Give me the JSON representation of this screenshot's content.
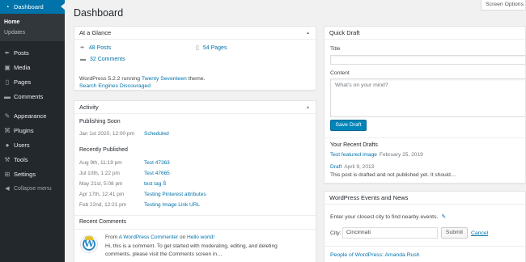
{
  "sidebar": {
    "dashboard": {
      "label": "Dashboard",
      "icon": "dashboard-icon",
      "glyph": "◔"
    },
    "submenu": [
      {
        "label": "Home"
      },
      {
        "label": "Updates"
      }
    ],
    "items": [
      {
        "label": "Posts",
        "icon": "pushpin-icon",
        "glyph": "✒"
      },
      {
        "label": "Media",
        "icon": "media-icon",
        "glyph": "▣"
      },
      {
        "label": "Pages",
        "icon": "pages-icon",
        "glyph": "▯"
      },
      {
        "label": "Comments",
        "icon": "comment-icon",
        "glyph": "▬"
      },
      {
        "label": "Appearance",
        "icon": "paintbrush-icon",
        "glyph": "✎"
      },
      {
        "label": "Plugins",
        "icon": "plugin-icon",
        "glyph": "⌘"
      },
      {
        "label": "Users",
        "icon": "users-icon",
        "glyph": "●"
      },
      {
        "label": "Tools",
        "icon": "wrench-icon",
        "glyph": "⚒"
      },
      {
        "label": "Settings",
        "icon": "settings-icon",
        "glyph": "⊞"
      },
      {
        "label": "Collapse menu",
        "icon": "collapse-icon",
        "glyph": "◀"
      }
    ]
  },
  "header": {
    "title": "Dashboard",
    "screen_options": "Screen Options"
  },
  "glance": {
    "title": "At a Glance",
    "posts": "48 Posts",
    "pages": "54 Pages",
    "comments": "32 Comments",
    "version_prefix": "WordPress 5.2.2 running ",
    "theme": "Twenty Seventeen",
    "version_suffix": " theme.",
    "seo": "Search Engines Discouraged"
  },
  "activity": {
    "title": "Activity",
    "publishing_soon": "Publishing Soon",
    "scheduled": [
      {
        "date": "Jan 1st 2020, 12:00 pm",
        "title": "Scheduled"
      }
    ],
    "recently_published": "Recently Published",
    "published": [
      {
        "date": "Aug 9th, 11:19 pm",
        "title": "Test 47363"
      },
      {
        "date": "Jul 10th, 1:22 pm",
        "title": "Test 47665"
      },
      {
        "date": "May 21st, 5:08 pm",
        "title": "test tag Ŝ"
      },
      {
        "date": "Apr 17th, 12:41 pm",
        "title": "Testing Pinterest attributes"
      },
      {
        "date": "Feb 22nd, 12:21 pm",
        "title": "Testing Image Link URL"
      }
    ],
    "recent_comments": "Recent Comments",
    "comment": {
      "from": "From ",
      "author": "A WordPress Commenter",
      "on": " on ",
      "post": "Hello world!",
      "line1": "Hi, this is a comment. To get started with moderating, editing, and deleting",
      "line2": "comments, please visit the Comments screen in…"
    }
  },
  "quick_draft": {
    "title": "Quick Draft",
    "title_label": "Title",
    "title_value": "",
    "content_label": "Content",
    "content_placeholder": "What’s on your mind?",
    "save_label": "Save Draft",
    "recent_title": "Your Recent Drafts",
    "drafts": [
      {
        "title": "Test featured image",
        "date": "February 25, 2019"
      },
      {
        "title": "Draft",
        "date": "April 9, 2013"
      }
    ],
    "draft_excerpt": "This post is drafted and not published yet. It should…"
  },
  "events": {
    "title": "WordPress Events and News",
    "intro": "Enter your closest city to find nearby events.",
    "city_label": "City:",
    "city_value": "Cincinnati",
    "submit_label": "Submit",
    "cancel_label": "Cancel",
    "news": "People of WordPress: Amanda Rush"
  }
}
